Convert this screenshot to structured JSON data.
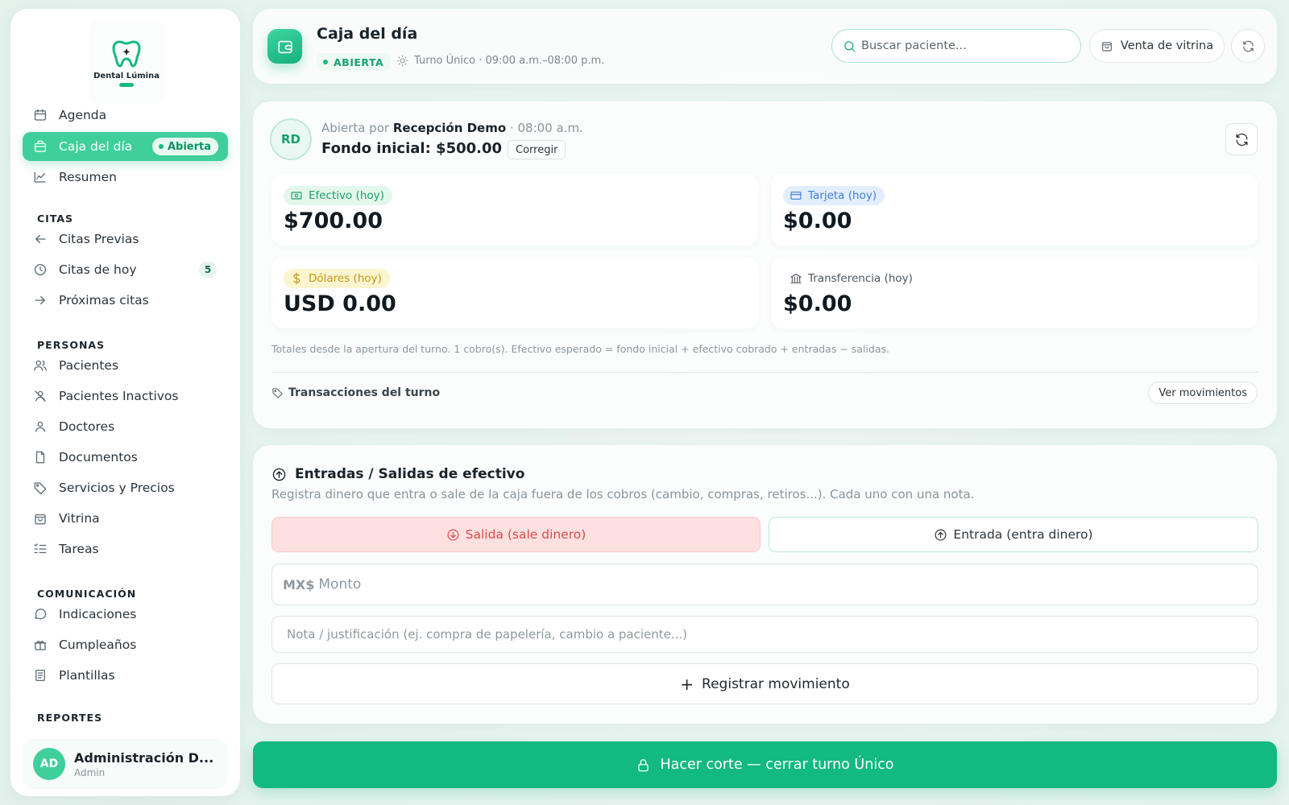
{
  "brand": {
    "name": "Dental Lúmina",
    "accent": "#16b981"
  },
  "sidebar": {
    "items_top": [
      {
        "label": "Agenda",
        "icon": "calendar-icon"
      },
      {
        "label": "Caja del día",
        "icon": "wallet-icon",
        "active": true,
        "pill": "Abierta"
      },
      {
        "label": "Resumen",
        "icon": "trend-icon"
      }
    ],
    "sections": {
      "citas": "CITAS",
      "personas": "PERSONAS",
      "comunicacion": "COMUNICACIÓN",
      "reportes": "REPORTES"
    },
    "citas": [
      {
        "label": "Citas Previas",
        "icon": "arrow-left-icon"
      },
      {
        "label": "Citas de hoy",
        "icon": "clock-icon",
        "count": "5"
      },
      {
        "label": "Próximas citas",
        "icon": "arrow-right-icon"
      }
    ],
    "personas": [
      {
        "label": "Pacientes",
        "icon": "users-icon"
      },
      {
        "label": "Pacientes Inactivos",
        "icon": "user-x-icon"
      },
      {
        "label": "Doctores",
        "icon": "user-icon"
      },
      {
        "label": "Documentos",
        "icon": "file-icon"
      },
      {
        "label": "Servicios y Precios",
        "icon": "tag-icon"
      },
      {
        "label": "Vitrina",
        "icon": "bag-icon"
      },
      {
        "label": "Tareas",
        "icon": "list-check-icon"
      }
    ],
    "comunicacion": [
      {
        "label": "Indicaciones",
        "icon": "chat-icon"
      },
      {
        "label": "Cumpleaños",
        "icon": "gift-icon"
      },
      {
        "label": "Plantillas",
        "icon": "template-icon"
      }
    ],
    "user": {
      "initials": "AD",
      "name": "Administración D...",
      "role": "Admin"
    }
  },
  "header": {
    "title": "Caja del día",
    "status": "ABIERTA",
    "shift": "Turno Único · 09:00 a.m.–08:00 p.m.",
    "search_placeholder": "Buscar paciente...",
    "vitrina_label": "Venta de vitrina"
  },
  "summary": {
    "initials": "RD",
    "opened_prefix": "Abierta por",
    "opened_by": "Recepción Demo",
    "opened_time": "· 08:00 a.m.",
    "fondo": "Fondo inicial: $500.00",
    "corregir": "Corregir",
    "stats": [
      {
        "label": "Efectivo (hoy)",
        "value": "$700.00",
        "icon": "cash-icon",
        "color": "#1ea06c"
      },
      {
        "label": "Tarjeta (hoy)",
        "value": "$0.00",
        "icon": "card-icon",
        "color": "#3d7fd6"
      },
      {
        "label": "Dólares (hoy)",
        "value": "USD 0.00",
        "icon": "dollar-icon",
        "color": "#c39614"
      },
      {
        "label": "Transferencia (hoy)",
        "value": "$0.00",
        "icon": "bank-icon",
        "color": "#4c565d"
      }
    ],
    "note": "Totales desde la apertura del turno. 1 cobro(s). Efectivo esperado = fondo inicial + efectivo cobrado + entradas − salidas.",
    "transactions_title": "Transacciones del turno",
    "ver_movimientos": "Ver movimientos"
  },
  "movements": {
    "title": "Entradas / Salidas de efectivo",
    "description": "Registra dinero que entra o sale de la caja fuera de los cobros (cambio, compras, retiros...). Cada uno con una nota.",
    "out_label": "Salida (sale dinero)",
    "in_label": "Entrada (entra dinero)",
    "currency_prefix": "MX$",
    "amount_placeholder": "Monto",
    "note_placeholder": "Nota / justificación (ej. compra de papelería, cambio a paciente...)",
    "register_label": "Registrar movimiento"
  },
  "footer": {
    "close_label": "Hacer corte — cerrar turno Único"
  }
}
